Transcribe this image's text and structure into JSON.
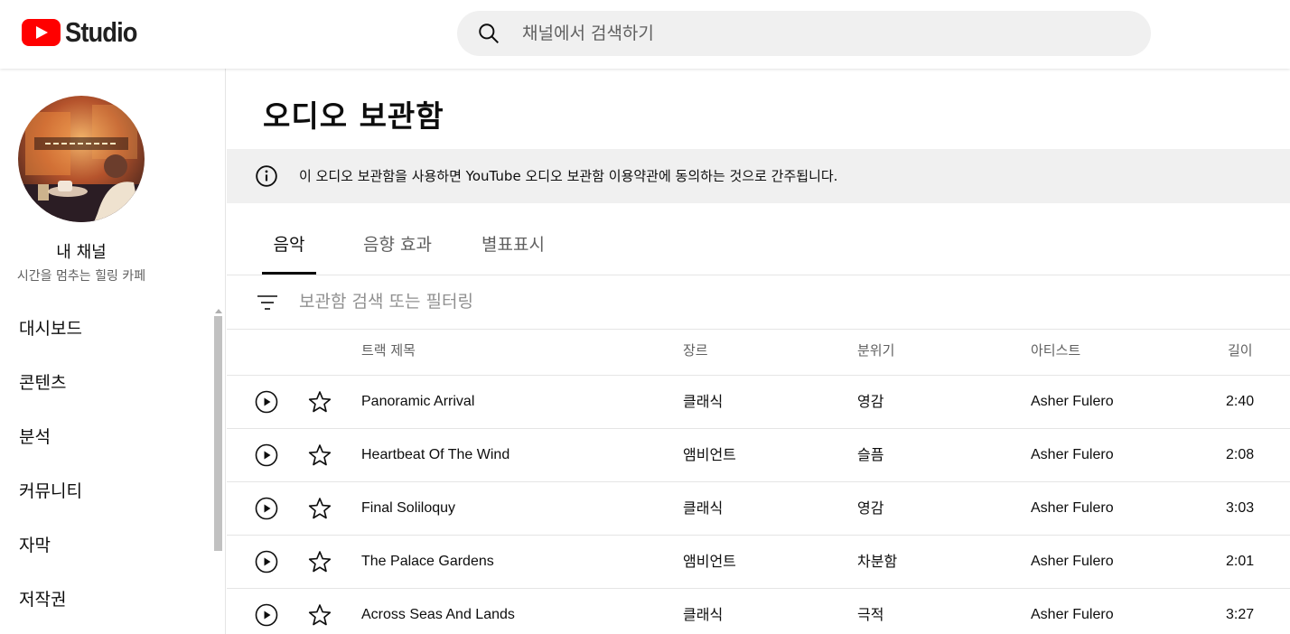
{
  "header": {
    "logo_text": "Studio",
    "search_placeholder": "채널에서 검색하기"
  },
  "sidebar": {
    "channel_label": "내 채널",
    "channel_name": "시간을 멈추는 힐링 카페",
    "items": [
      {
        "label": "대시보드"
      },
      {
        "label": "콘텐츠"
      },
      {
        "label": "분석"
      },
      {
        "label": "커뮤니티"
      },
      {
        "label": "자막"
      },
      {
        "label": "저작권"
      }
    ]
  },
  "main": {
    "title": "오디오 보관함",
    "notice": "이 오디오 보관함을 사용하면 YouTube 오디오 보관함 이용약관에 동의하는 것으로 간주됩니다.",
    "tabs": [
      {
        "label": "음악",
        "active": true
      },
      {
        "label": "음향 효과",
        "active": false
      },
      {
        "label": "별표표시",
        "active": false
      }
    ],
    "filter_placeholder": "보관함 검색 또는 필터링",
    "columns": {
      "title": "트랙 제목",
      "genre": "장르",
      "mood": "분위기",
      "artist": "아티스트",
      "length": "길이"
    },
    "tracks": [
      {
        "title": "Panoramic Arrival",
        "genre": "클래식",
        "mood": "영감",
        "artist": "Asher Fulero",
        "length": "2:40"
      },
      {
        "title": "Heartbeat Of The Wind",
        "genre": "앰비언트",
        "mood": "슬픔",
        "artist": "Asher Fulero",
        "length": "2:08"
      },
      {
        "title": "Final Soliloquy",
        "genre": "클래식",
        "mood": "영감",
        "artist": "Asher Fulero",
        "length": "3:03"
      },
      {
        "title": "The Palace Gardens",
        "genre": "앰비언트",
        "mood": "차분함",
        "artist": "Asher Fulero",
        "length": "2:01"
      },
      {
        "title": "Across Seas And Lands",
        "genre": "클래식",
        "mood": "극적",
        "artist": "Asher Fulero",
        "length": "3:27"
      }
    ]
  },
  "colors": {
    "brand_red": "#ff0000",
    "text_primary": "#0d0d0d",
    "text_secondary": "#606060",
    "surface_gray": "#f0f0f0"
  },
  "icons": [
    "youtube-logo-icon",
    "search-icon",
    "info-icon",
    "filter-icon",
    "play-icon",
    "star-icon"
  ]
}
